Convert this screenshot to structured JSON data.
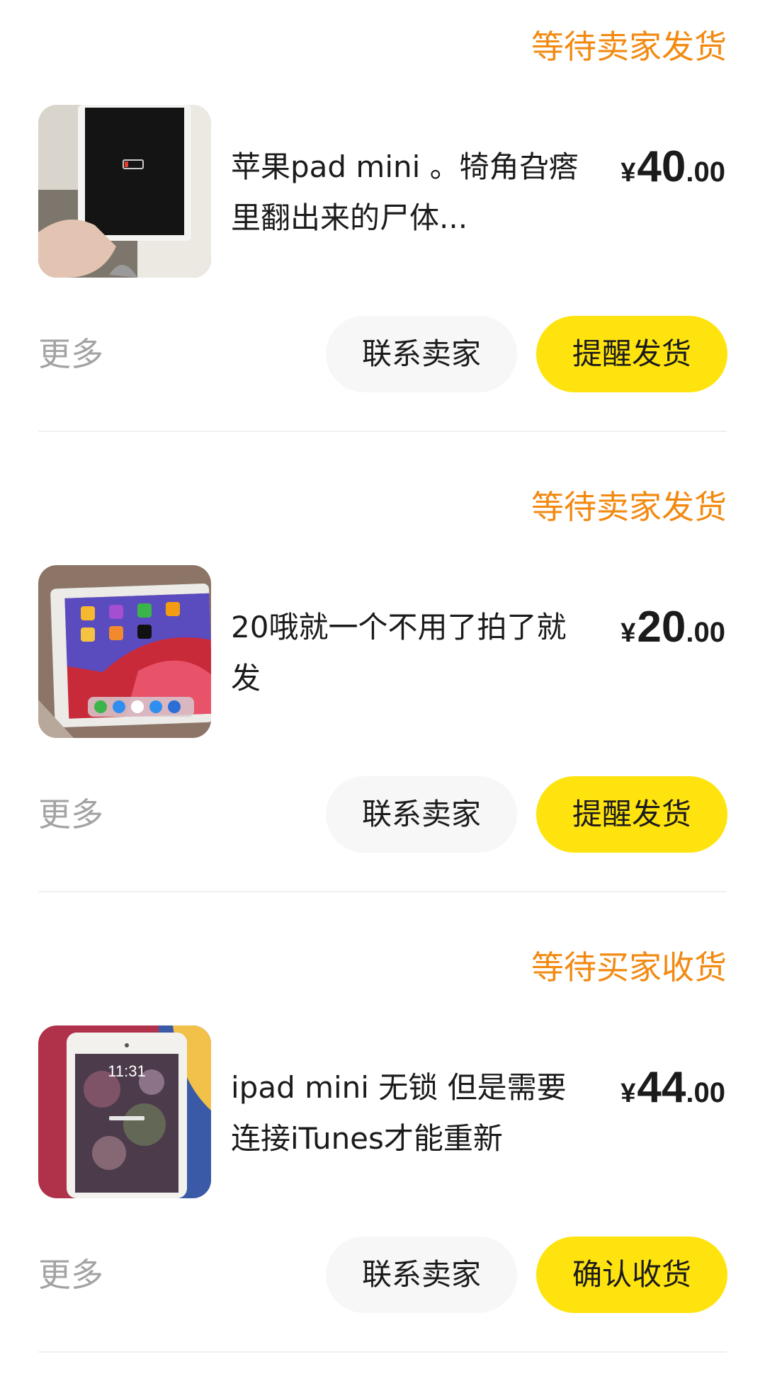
{
  "orders": [
    {
      "status": "等待卖家发货",
      "title": "苹果pad mini  。犄角旮瘩里翻出来的尸体...",
      "price": {
        "currency": "¥",
        "integer": "40",
        "decimal": ".00"
      },
      "more_label": "更多",
      "contact_label": "联系卖家",
      "primary_label": "提醒发货"
    },
    {
      "status": "等待卖家发货",
      "title": "20哦就一个不用了拍了就发",
      "price": {
        "currency": "¥",
        "integer": "20",
        "decimal": ".00"
      },
      "more_label": "更多",
      "contact_label": "联系卖家",
      "primary_label": "提醒发货"
    },
    {
      "status": "等待买家收货",
      "title": "ipad mini   无锁 但是需要连接iTunes才能重新",
      "price": {
        "currency": "¥",
        "integer": "44",
        "decimal": ".00"
      },
      "more_label": "更多",
      "contact_label": "联系卖家",
      "primary_label": "确认收货"
    }
  ],
  "theme": {
    "status_color": "#f28a12",
    "primary_button_color": "#ffe30f",
    "secondary_button_color": "#f7f7f7",
    "muted_text_color": "#a3a3a3"
  }
}
